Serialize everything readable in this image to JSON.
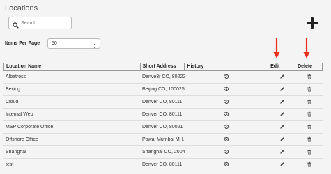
{
  "page": {
    "title": "Locations"
  },
  "search": {
    "placeholder": "Search..."
  },
  "items_per_page": {
    "label": "Items Per Page",
    "value": "50"
  },
  "table": {
    "headers": {
      "name": "Location Name",
      "address": "Short Address",
      "history": "History",
      "edit": "Edit",
      "delete": "Delete"
    },
    "rows": [
      {
        "name": "Albatross",
        "address": "Denve3r CO, 80222"
      },
      {
        "name": "Beijing",
        "address": "Beijing CO, 100025"
      },
      {
        "name": "Cloud",
        "address": "Denver CO, 80111"
      },
      {
        "name": "Internal Web",
        "address": "Denver CO, 80111"
      },
      {
        "name": "MSP Corporate Office",
        "address": "Denver CO, 80021"
      },
      {
        "name": "Offshore Office",
        "address": "Powai Mumbai MH, 400076"
      },
      {
        "name": "Shanghai",
        "address": "Shanghai CO, 200433"
      },
      {
        "name": "test",
        "address": "Denver CO, 80111"
      }
    ]
  },
  "colors": {
    "annotation_arrow": "#e8321e"
  },
  "icons": {
    "search": "search-icon",
    "add": "plus-icon",
    "history": "history-icon",
    "edit": "pencil-icon",
    "delete": "trash-icon"
  }
}
